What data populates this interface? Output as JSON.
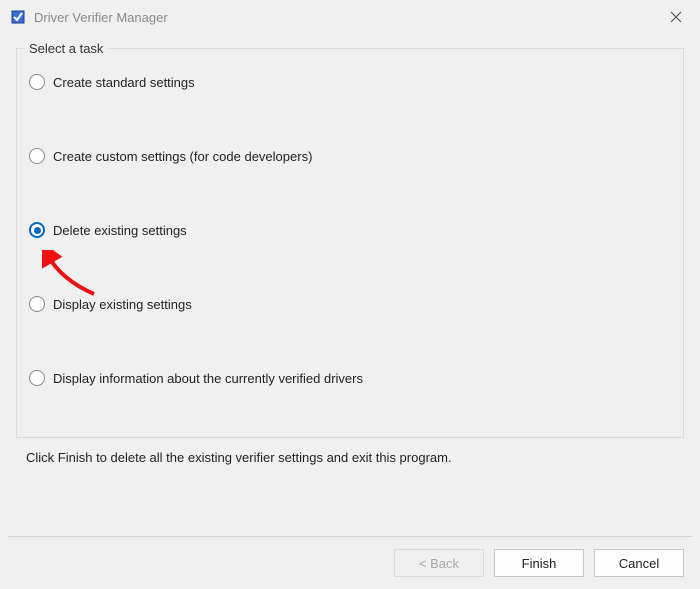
{
  "window": {
    "title": "Driver Verifier Manager"
  },
  "group_label": "Select a task",
  "options": {
    "create_standard": "Create standard settings",
    "create_custom": "Create custom settings (for code developers)",
    "delete_existing": "Delete existing settings",
    "display_existing": "Display existing settings",
    "display_info": "Display information about the currently verified drivers"
  },
  "selected_option": "delete_existing",
  "hint": "Click Finish to delete all the existing verifier settings and exit this program.",
  "buttons": {
    "back": "< Back",
    "finish": "Finish",
    "cancel": "Cancel"
  }
}
